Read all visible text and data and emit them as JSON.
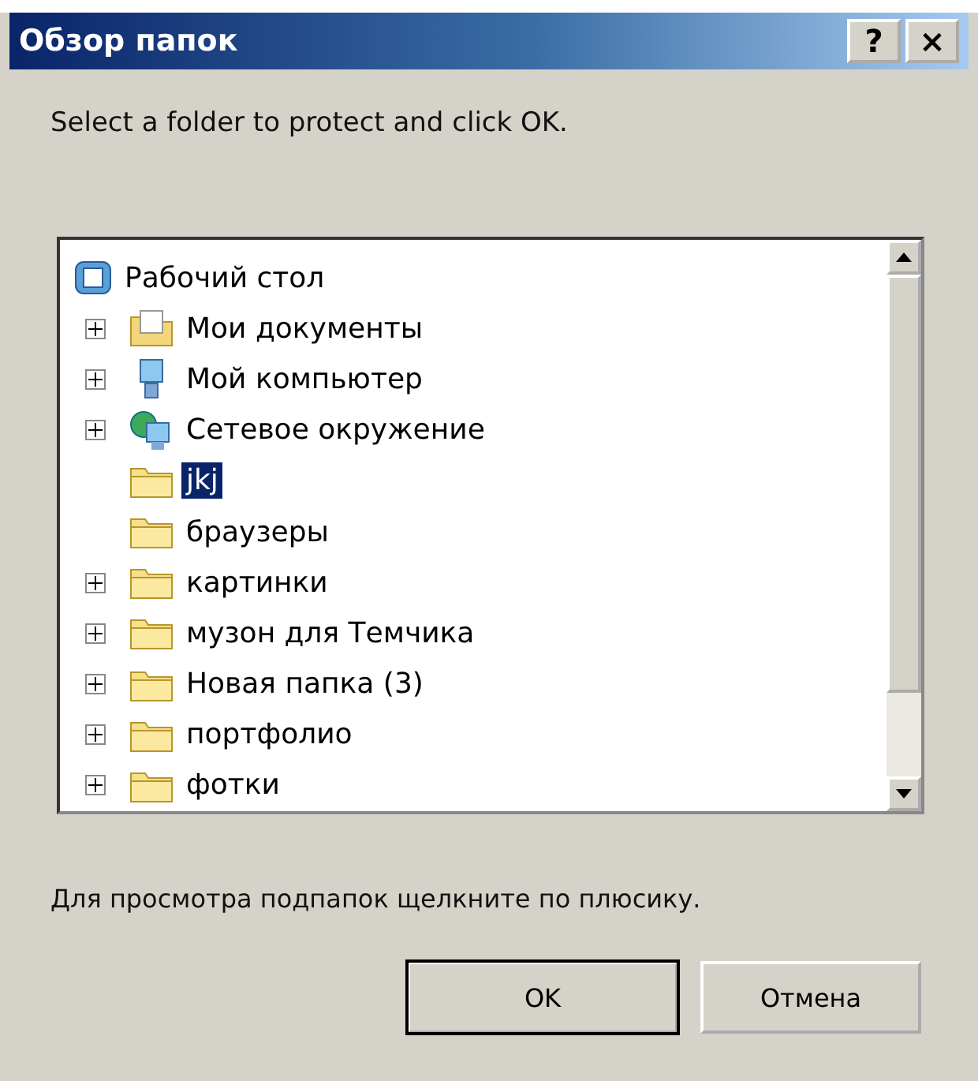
{
  "window": {
    "title": "Обзор папок",
    "help_button": "?",
    "close_button": "×"
  },
  "instruction": "Select a folder to protect and click OK.",
  "tree": {
    "items": [
      {
        "label": "Рабочий стол",
        "kind": "desktop",
        "selected": false,
        "children": [
          {
            "label": "Мои документы",
            "kind": "documents",
            "expandable": true,
            "selected": false
          },
          {
            "label": "Мой компьютер",
            "kind": "computer",
            "expandable": true,
            "selected": false
          },
          {
            "label": "Сетевое окружение",
            "kind": "network",
            "expandable": true,
            "selected": false
          },
          {
            "label": "jkj",
            "kind": "folder",
            "expandable": false,
            "selected": true
          },
          {
            "label": "браузеры",
            "kind": "folder",
            "expandable": false,
            "selected": false
          },
          {
            "label": "картинки",
            "kind": "folder",
            "expandable": true,
            "selected": false
          },
          {
            "label": "музон для Темчика",
            "kind": "folder",
            "expandable": true,
            "selected": false
          },
          {
            "label": "Новая папка (3)",
            "kind": "folder",
            "expandable": true,
            "selected": false
          },
          {
            "label": "портфолио",
            "kind": "folder",
            "expandable": true,
            "selected": false
          },
          {
            "label": "фотки",
            "kind": "folder",
            "expandable": true,
            "selected": false
          }
        ]
      }
    ]
  },
  "hint": "Для просмотра подпапок щелкните по плюсику.",
  "buttons": [
    {
      "label": "OK",
      "default": true
    },
    {
      "label": "Отмена",
      "default": false
    }
  ]
}
